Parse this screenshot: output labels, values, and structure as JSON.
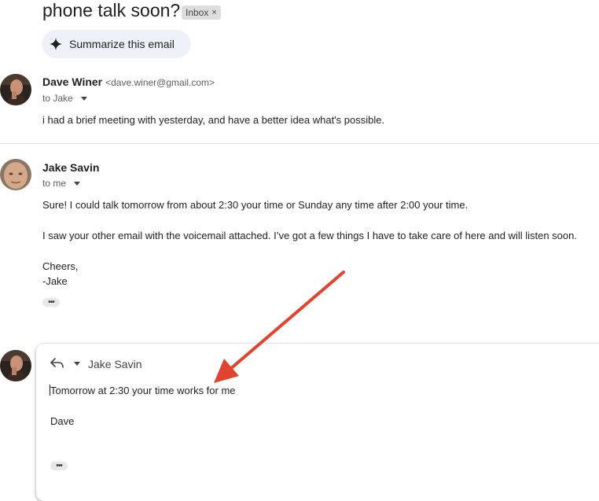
{
  "thread": {
    "subject": "phone talk soon?",
    "label": "Inbox",
    "label_remove_icon": "×"
  },
  "summarize_button": {
    "label": "Summarize this email",
    "icon": "sparkle-icon"
  },
  "messages": [
    {
      "sender_name": "Dave Winer",
      "sender_email": "<dave.winer@gmail.com>",
      "to": "to Jake",
      "body": [
        "i had a brief meeting with            yesterday, and have a better idea what's possible."
      ]
    },
    {
      "sender_name": "Jake Savin",
      "to": "to me",
      "body": [
        "Sure! I could talk tomorrow from about 2:30 your time or Sunday any time after 2:00 your time.",
        "I saw your other email with the voicemail attached. I’ve got a few things I have to take care of here and will listen soon.",
        "Cheers,",
        "-Jake"
      ],
      "more_icon": "•••"
    }
  ],
  "reply": {
    "recipient": "Jake Savin",
    "reply_icon": "reply-icon",
    "body_lines": [
      "Tomorrow at 2:30 your time works for me",
      "Dave"
    ],
    "more_icon": "•••"
  },
  "colors": {
    "annotation_arrow": "#e0432e",
    "chip_bg": "#dddddd",
    "summarize_bg": "#eef2f8"
  }
}
